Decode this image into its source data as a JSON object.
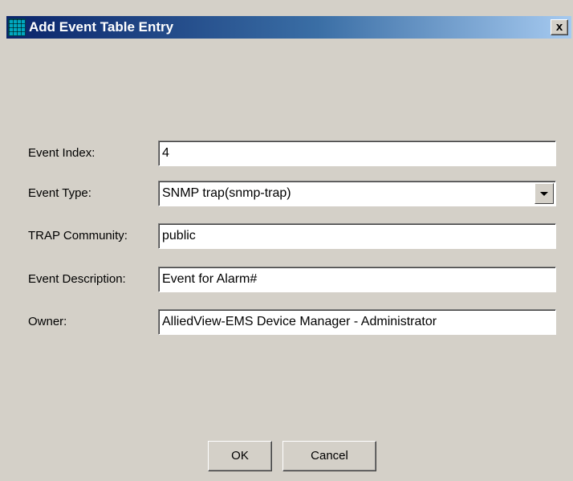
{
  "window": {
    "title": "Add Event Table Entry",
    "title_icon": "grid-app-icon",
    "close_label": "x"
  },
  "form": {
    "event_index": {
      "label": "Event Index:",
      "value": "4"
    },
    "event_type": {
      "label": "Event Type:",
      "value": "SNMP trap(snmp-trap)",
      "icon": "chevron-down-icon"
    },
    "trap_community": {
      "label": "TRAP Community:",
      "value": "public"
    },
    "event_description": {
      "label": "Event Description:",
      "value": "Event for Alarm#"
    },
    "owner": {
      "label": "Owner:",
      "value": "AlliedView-EMS Device Manager - Administrator"
    }
  },
  "buttons": {
    "ok_label": "OK",
    "cancel_label": "Cancel"
  },
  "colors": {
    "titlebar_start": "#0a246a",
    "titlebar_end": "#a6caf0",
    "dialog_background": "#d4d0c8"
  }
}
